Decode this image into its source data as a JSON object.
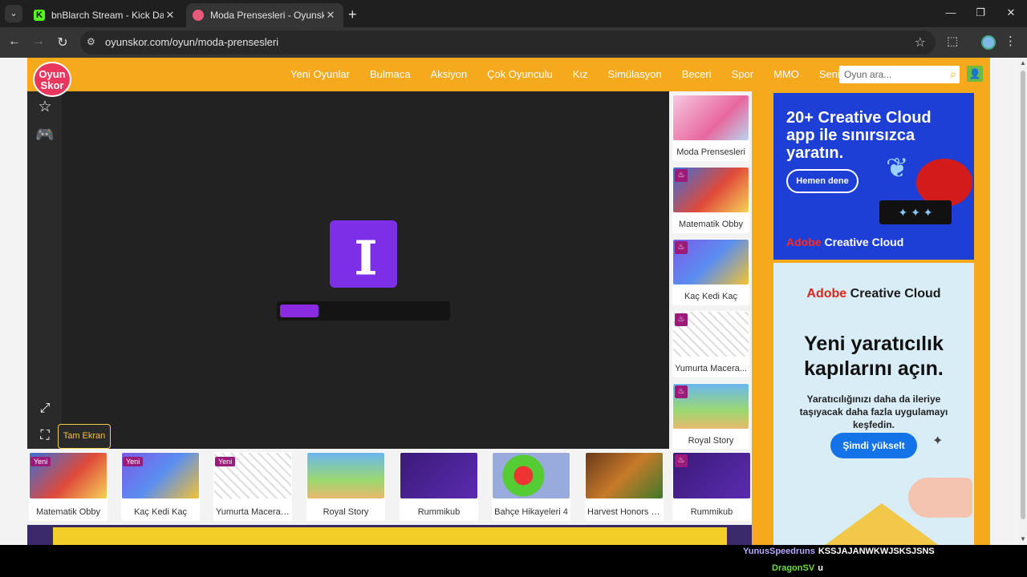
{
  "browser": {
    "tabs": [
      {
        "title": "bnBlarch Stream - Kick Dashbo",
        "favicon": "kick-icon",
        "active": false
      },
      {
        "title": "Moda Prensesleri - Oyunskor.co",
        "favicon": "oyunskor-icon",
        "active": true
      }
    ],
    "url": "oyunskor.com/oyun/moda-prensesleri",
    "kick_glyph": "K"
  },
  "site": {
    "logo_line1": "Oyun",
    "logo_line2": "Skor",
    "menu": [
      "Yeni Oyunlar",
      "Bulmaca",
      "Aksiyon",
      "Çok Oyunculu",
      "Kız",
      "Simülasyon",
      "Beceri",
      "Spor",
      "MMO",
      "Senin için"
    ],
    "search_placeholder": "Oyun ara...",
    "tooltip": "Tam Ekran",
    "game_logo": "][",
    "loading_progress_percent": 23
  },
  "related_vertical": [
    {
      "label": "Moda Prensesleri",
      "badge": ""
    },
    {
      "label": "Matematik Obby",
      "badge": "flame"
    },
    {
      "label": "Kaç Kedi Kaç",
      "badge": "flame"
    },
    {
      "label": "Yumurta Macera...",
      "badge": "flame"
    },
    {
      "label": "Royal Story",
      "badge": "flame"
    }
  ],
  "related_horizontal": [
    {
      "label": "Matematik Obby",
      "badge": "Yeni"
    },
    {
      "label": "Kaç Kedi Kaç",
      "badge": "Yeni"
    },
    {
      "label": "Yumurta Macerası...",
      "badge": "Yeni"
    },
    {
      "label": "Royal Story",
      "badge": ""
    },
    {
      "label": "Rummikub",
      "badge": ""
    },
    {
      "label": "Bahçe Hikayeleri 4",
      "badge": ""
    },
    {
      "label": "Harvest Honors Cl...",
      "badge": ""
    },
    {
      "label": "Rummikub",
      "badge": "flame"
    }
  ],
  "ads": {
    "ad1": {
      "headline": "20+ Creative Cloud app ile sınırsızca yaratın.",
      "button": "Hemen dene",
      "brand": "Adobe",
      "brand_rest": " Creative Cloud"
    },
    "ad2": {
      "brand": "Adobe",
      "brand_rest": " Creative Cloud",
      "headline": "Yeni yaratıcılık kapılarını açın.",
      "sub": "Yaratıcılığınızı daha da ileriye taşıyacak daha fazla uygulamayı keşfedin.",
      "button": "Şimdi yükselt"
    }
  },
  "chat": [
    {
      "user": "YunusSpeedruns",
      "message": "KSSJAJANWKWJSKSJSNS",
      "color": "#b7a8ff"
    },
    {
      "user": "DragonSV",
      "message": "u",
      "color": "#6fdc3c"
    }
  ],
  "colors": {
    "accent": "#f5a91d",
    "game_purple": "#7c2fe6",
    "badge": "#9b1b7a"
  }
}
